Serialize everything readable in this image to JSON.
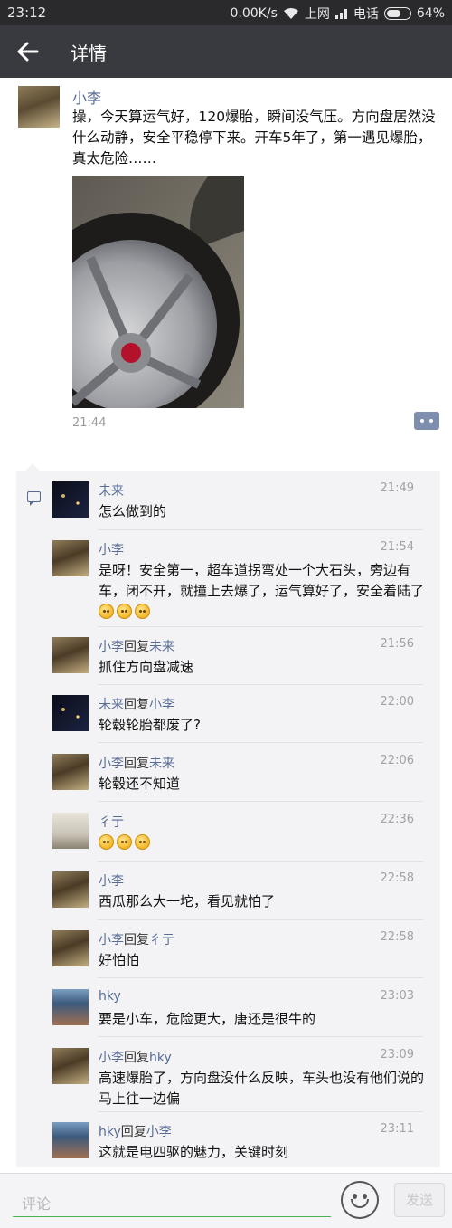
{
  "status_bar": {
    "time": "23:12",
    "net_speed": "0.00K/s",
    "carrier1": "上网",
    "carrier2": "电话",
    "battery": "64%",
    "battery_level": 0.64
  },
  "header": {
    "title": "详情"
  },
  "post": {
    "author": "小李",
    "text": "操，今天算运气好，120爆胎，瞬间没气压。方向盘居然没什么动静，安全平稳停下来。开车5年了，第一遇见爆胎，真太危险……",
    "time": "21:44"
  },
  "comments": [
    {
      "name": "未来",
      "reply_word": "",
      "reply_to": "",
      "time": "21:49",
      "text": "怎么做到的",
      "avatar": "avatar-weilai"
    },
    {
      "name": "小李",
      "reply_word": "",
      "reply_to": "",
      "time": "21:54",
      "text": "是呀！安全第一，超车道拐弯处一个大石头，旁边有车，闭不开，就撞上去爆了，运气算好了，安全着陆了",
      "emojis": 3,
      "avatar": "avatar-xiaoli"
    },
    {
      "name": "小李",
      "reply_word": "回复",
      "reply_to": "未来",
      "time": "21:56",
      "text": "抓住方向盘减速",
      "avatar": "avatar-xiaoli"
    },
    {
      "name": "未来",
      "reply_word": "回复",
      "reply_to": "小李",
      "time": "22:00",
      "text": "轮毂轮胎都废了?",
      "avatar": "avatar-weilai"
    },
    {
      "name": "小李",
      "reply_word": "回复",
      "reply_to": "未来",
      "time": "22:06",
      "text": "轮毂还不知道",
      "avatar": "avatar-xiaoli"
    },
    {
      "name": "彳亍",
      "reply_word": "",
      "reply_to": "",
      "time": "22:36",
      "text": "",
      "emojis": 3,
      "avatar": "avatar-chichu"
    },
    {
      "name": "小李",
      "reply_word": "",
      "reply_to": "",
      "time": "22:58",
      "text": "西瓜那么大一坨，看见就怕了",
      "avatar": "avatar-xiaoli"
    },
    {
      "name": "小李",
      "reply_word": "回复",
      "reply_to": "彳亍",
      "time": "22:58",
      "text": "好怕怕",
      "avatar": "avatar-xiaoli"
    },
    {
      "name": "hky",
      "reply_word": "",
      "reply_to": "",
      "time": "23:03",
      "text": "要是小车，危险更大，唐还是很牛的",
      "avatar": "avatar-hky"
    },
    {
      "name": "小李",
      "reply_word": "回复",
      "reply_to": "hky",
      "time": "23:09",
      "text": "高速爆胎了，方向盘没什么反映，车头也没有他们说的马上往一边偏",
      "avatar": "avatar-xiaoli"
    },
    {
      "name": "hky",
      "reply_word": "回复",
      "reply_to": "小李",
      "time": "23:11",
      "text": "这就是电四驱的魅力，关键时刻",
      "avatar": "avatar-hky"
    }
  ],
  "bottom_bar": {
    "placeholder": "评论",
    "send_label": "发送"
  },
  "colors": {
    "name_link": "#576b95",
    "title_bar": "#393a3f",
    "status_bar": "#2a2a2d",
    "input_underline": "#49b351"
  }
}
